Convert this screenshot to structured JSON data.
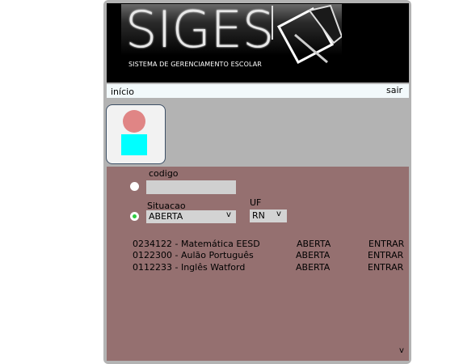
{
  "header": {
    "logo_text": "SIGES",
    "subtitle": "SISTEMA DE GERENCIAMENTO ESCOLAR"
  },
  "nav": {
    "home_label": "início",
    "logout_label": "sair"
  },
  "filters": {
    "codigo_label": "codigo",
    "codigo_value": "",
    "situacao_label": "Situacao",
    "situacao_value": "ABERTA",
    "uf_label": "UF",
    "uf_value": "RN",
    "dropdown_glyph": "v"
  },
  "classes": [
    {
      "code_name": "0234122 - Matemática EESD",
      "status": "ABERTA",
      "action": "ENTRAR"
    },
    {
      "code_name": "0122300 - Aulão Português",
      "status": "ABERTA",
      "action": "ENTRAR"
    },
    {
      "code_name": "0112233 - Inglês Watford",
      "status": "ABERTA",
      "action": "ENTRAR"
    }
  ],
  "footer": {
    "scroll_glyph": "v"
  },
  "colors": {
    "frame": "#b3b3b3",
    "header_bg": "#000000",
    "content_bg": "#957070",
    "avatar_head": "#e08585",
    "avatar_body": "#00ffff",
    "radio_selected": "#2ecc40"
  }
}
